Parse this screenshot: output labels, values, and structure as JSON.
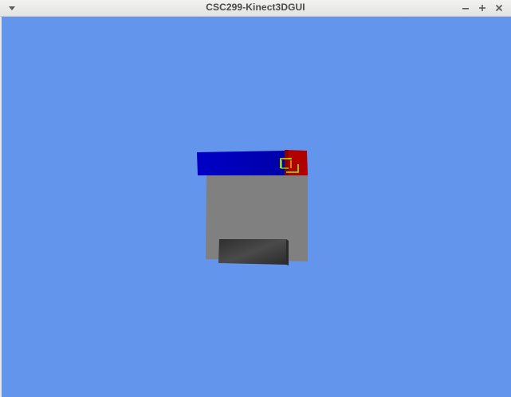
{
  "window": {
    "title": "CSC299-Kinect3DGUI",
    "icons": {
      "menu": "window-menu-icon",
      "minimize": "minimize-icon",
      "maximize": "maximize-icon",
      "close": "close-icon"
    },
    "colors": {
      "titlebar": "#e8e8e6",
      "title_text": "#4a4a4a"
    }
  },
  "viewport": {
    "background": "#6495ed",
    "scene": {
      "objects": [
        {
          "name": "blue-bar",
          "color": "#0000c8"
        },
        {
          "name": "red-block",
          "color": "#b00000"
        },
        {
          "name": "gray-panel",
          "color": "#808080"
        },
        {
          "name": "dark-block",
          "color": "#3c3c3c"
        },
        {
          "name": "cursor-marker",
          "icon": "bracket-cursor-icon",
          "colors": [
            "#7cff00",
            "#e0e000"
          ]
        }
      ]
    }
  }
}
